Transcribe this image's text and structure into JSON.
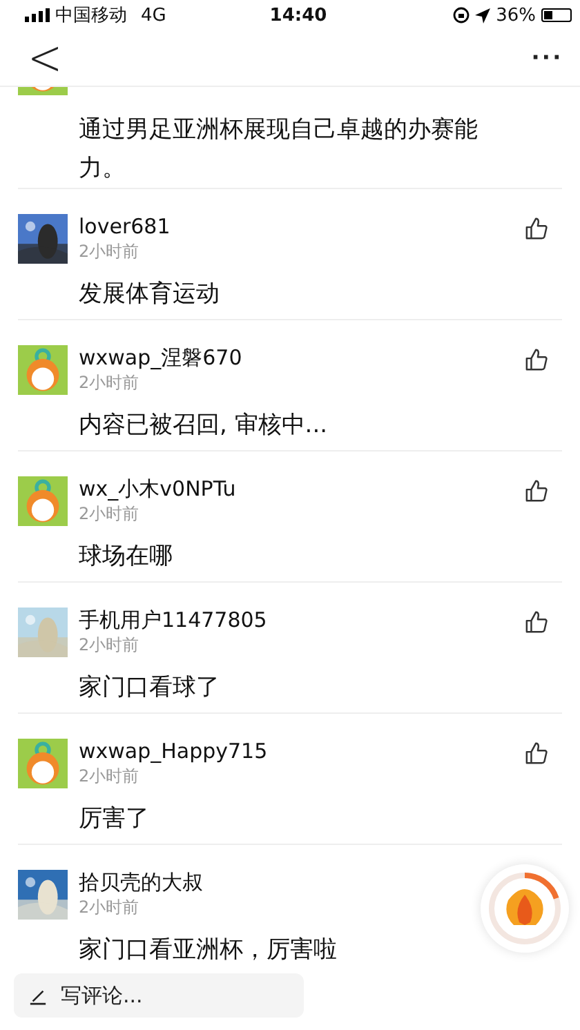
{
  "status_bar": {
    "carrier": "中国移动",
    "network": "4G",
    "time": "14:40",
    "battery": "36%"
  },
  "nav": {
    "back": "<",
    "more": "···"
  },
  "partial_comment": {
    "kind": "default",
    "text": "通过男足亚洲杯展现自己卓越的办赛能力。"
  },
  "comments": [
    {
      "name": "lover681",
      "time": "2小时前",
      "text": "发展体育运动"
    },
    {
      "kind": "default",
      "name": "wxwap_涅磐670",
      "time": "2小时前",
      "text": "内容已被召回, 审核中..."
    },
    {
      "kind": "default",
      "name": "wx_小木v0NPTu",
      "time": "2小时前",
      "text": "球场在哪"
    },
    {
      "name": "手机用户11477805",
      "time": "2小时前",
      "text": "家门口看球了"
    },
    {
      "kind": "default",
      "name": "wxwap_Happy715",
      "time": "2小时前",
      "text": "厉害了"
    },
    {
      "name": "拾贝壳的大叔",
      "time": "2小时前",
      "text": "家门口看亚洲杯，厉害啦"
    }
  ],
  "comment_box": {
    "placeholder": "写评论..."
  },
  "reward_button": {
    "level": 0.2
  }
}
